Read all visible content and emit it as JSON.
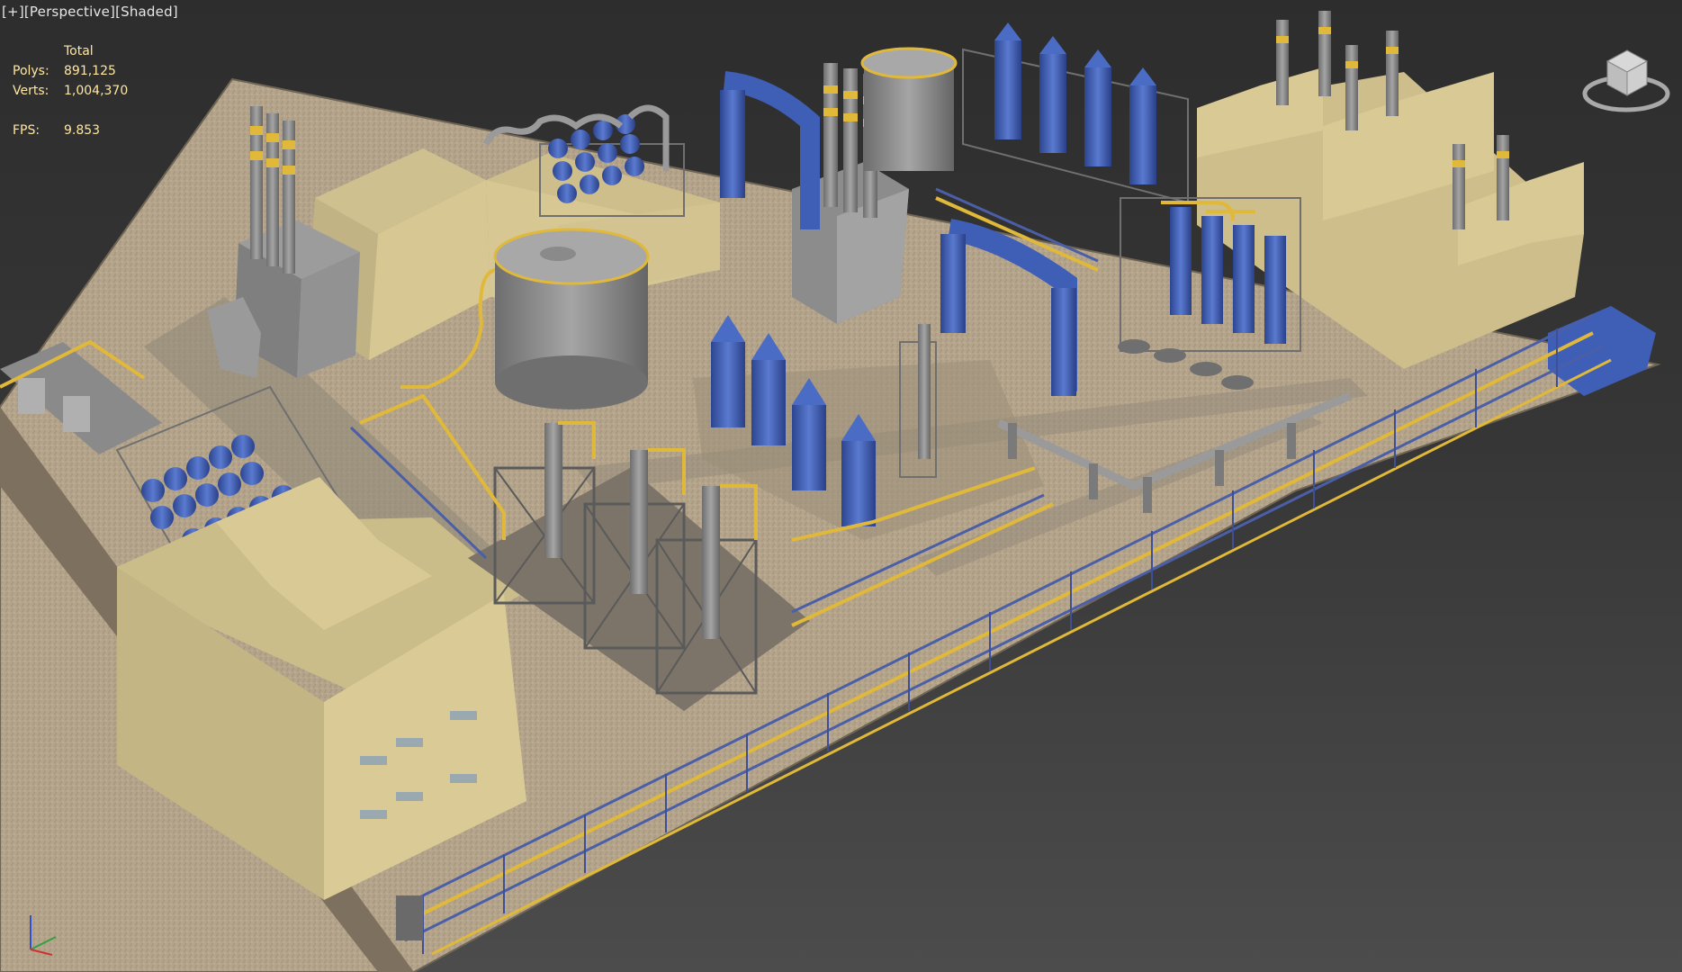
{
  "viewport": {
    "labels": {
      "plus": "[+]",
      "view": "[Perspective]",
      "shading": "[Shaded]"
    },
    "stats": {
      "header": "Total",
      "polys_label": "Polys:",
      "polys_value": "891,125",
      "verts_label": "Verts:",
      "verts_value": "1,004,370",
      "fps_label": "FPS:",
      "fps_value": "9.853"
    },
    "viewcube": {
      "icon": "viewcube-icon"
    },
    "axis_gizmo": {
      "icon": "axis-tripod-icon"
    }
  },
  "colors": {
    "ground": "#b3a38a",
    "building_wall": "#d7c893",
    "building_roof": "#cbbd89",
    "steel_gray": "#8c8c8c",
    "blue_equipment": "#3e5fb5",
    "pipe_yellow": "#e0b83a",
    "label_yellow": "#ffe7a0"
  }
}
